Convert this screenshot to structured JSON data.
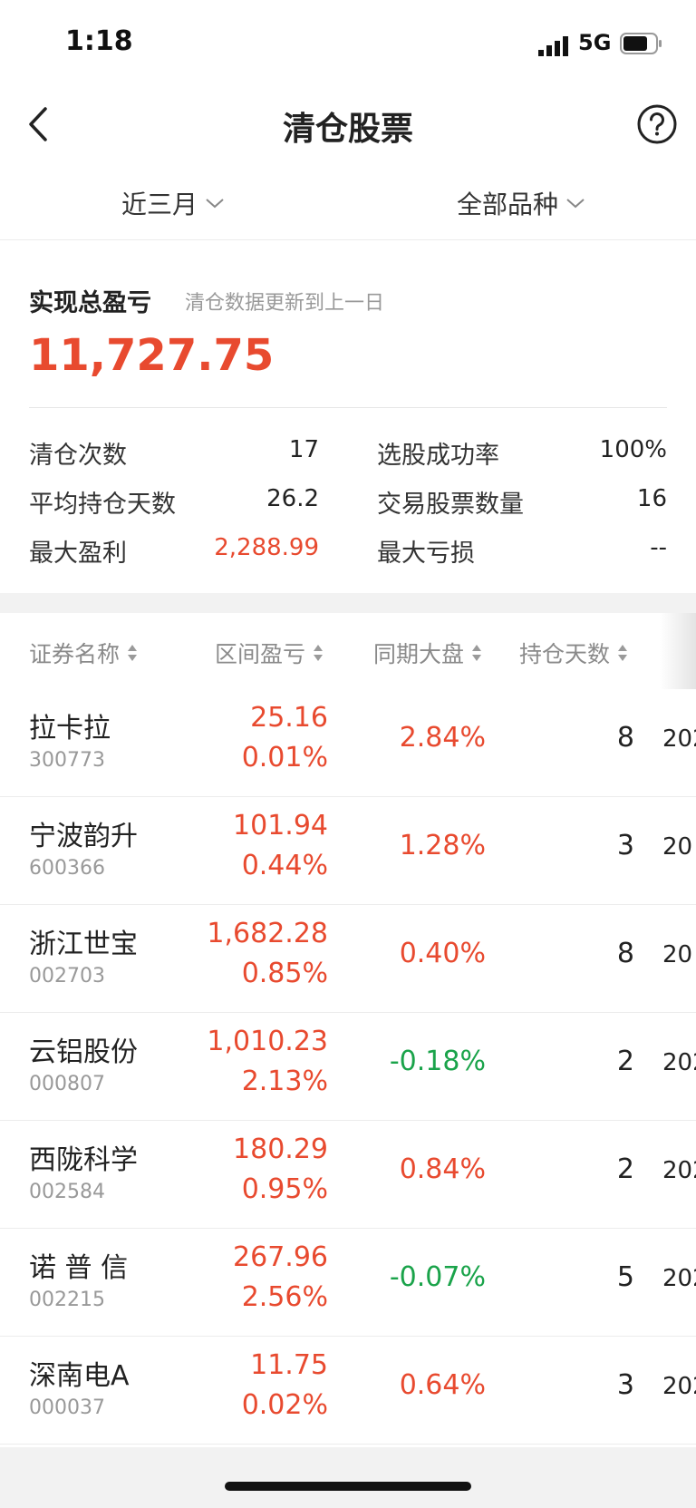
{
  "status_bar": {
    "time": "1:18",
    "network": "5G"
  },
  "nav": {
    "title": "清仓股票"
  },
  "filters": {
    "period": "近三月",
    "category": "全部品种"
  },
  "summary": {
    "title": "实现总盈亏",
    "note": "清仓数据更新到上一日",
    "total": "11,727.75",
    "stats": {
      "clear_count_label": "清仓次数",
      "clear_count": "17",
      "success_rate_label": "选股成功率",
      "success_rate": "100%",
      "avg_days_label": "平均持仓天数",
      "avg_days": "26.2",
      "stock_count_label": "交易股票数量",
      "stock_count": "16",
      "max_profit_label": "最大盈利",
      "max_profit": "2,288.99",
      "max_loss_label": "最大亏损",
      "max_loss": "--"
    }
  },
  "table": {
    "headers": [
      "证券名称",
      "区间盈亏",
      "同期大盘",
      "持仓天数"
    ],
    "rows": [
      {
        "name": "拉卡拉",
        "code": "300773",
        "pl": "25.16",
        "pl_pct": "0.01%",
        "market": "2.84%",
        "market_color": "#e84a2f",
        "days": "8",
        "date": "202"
      },
      {
        "name": "宁波韵升",
        "code": "600366",
        "pl": "101.94",
        "pl_pct": "0.44%",
        "market": "1.28%",
        "market_color": "#e84a2f",
        "days": "3",
        "date": "20"
      },
      {
        "name": "浙江世宝",
        "code": "002703",
        "pl": "1,682.28",
        "pl_pct": "0.85%",
        "market": "0.40%",
        "market_color": "#e84a2f",
        "days": "8",
        "date": "20"
      },
      {
        "name": "云铝股份",
        "code": "000807",
        "pl": "1,010.23",
        "pl_pct": "2.13%",
        "market": "-0.18%",
        "market_color": "#1aa34a",
        "days": "2",
        "date": "202"
      },
      {
        "name": "西陇科学",
        "code": "002584",
        "pl": "180.29",
        "pl_pct": "0.95%",
        "market": "0.84%",
        "market_color": "#e84a2f",
        "days": "2",
        "date": "202"
      },
      {
        "name": "诺 普 信",
        "code": "002215",
        "pl": "267.96",
        "pl_pct": "2.56%",
        "market": "-0.07%",
        "market_color": "#1aa34a",
        "days": "5",
        "date": "202"
      },
      {
        "name": "深南电A",
        "code": "000037",
        "pl": "11.75",
        "pl_pct": "0.02%",
        "market": "0.64%",
        "market_color": "#e84a2f",
        "days": "3",
        "date": "202"
      }
    ]
  },
  "colors": {
    "profit_red": "#e84a2f",
    "loss_green": "#1aa34a",
    "label_gray": "#8a8a8a"
  }
}
